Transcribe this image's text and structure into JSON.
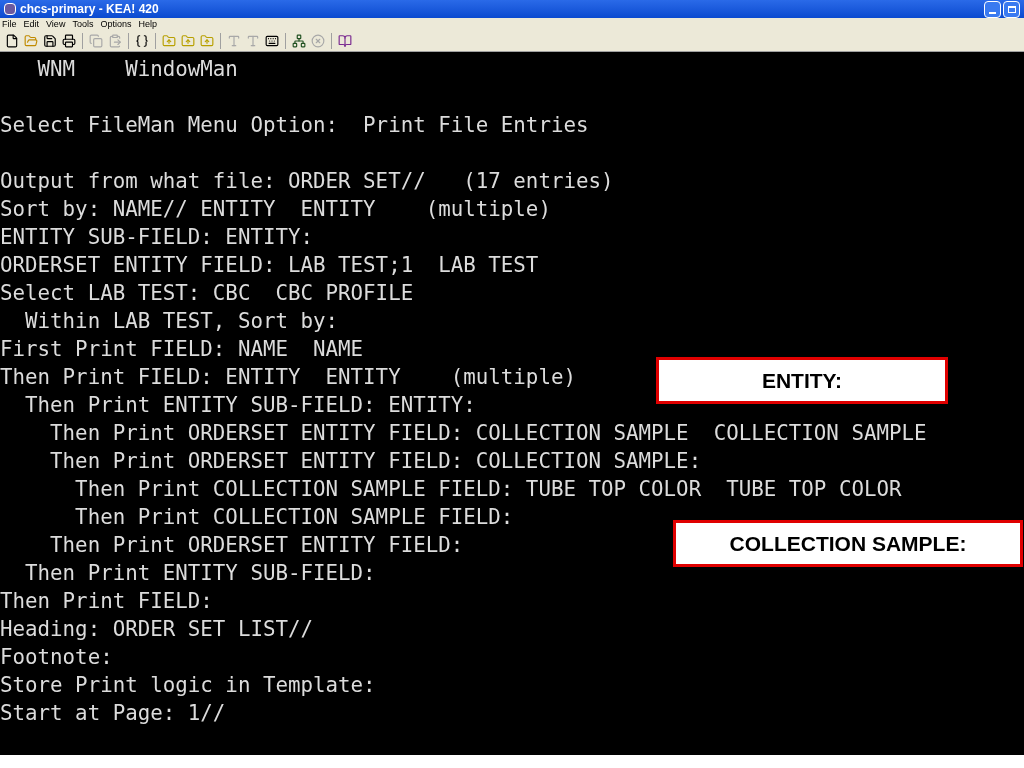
{
  "window": {
    "title": "chcs-primary - KEA! 420"
  },
  "menu": [
    "File",
    "Edit",
    "View",
    "Tools",
    "Options",
    "Help"
  ],
  "toolbar": [
    {
      "kind": "new",
      "disabled": false
    },
    {
      "kind": "open",
      "disabled": false
    },
    {
      "kind": "save",
      "disabled": false
    },
    {
      "kind": "print",
      "disabled": false
    },
    {
      "kind": "sep"
    },
    {
      "kind": "copy",
      "disabled": true
    },
    {
      "kind": "paste",
      "disabled": true
    },
    {
      "kind": "sep"
    },
    {
      "kind": "code",
      "disabled": false
    },
    {
      "kind": "sep"
    },
    {
      "kind": "folder-up",
      "disabled": false
    },
    {
      "kind": "folder-up",
      "disabled": false
    },
    {
      "kind": "folder-up",
      "disabled": false
    },
    {
      "kind": "sep"
    },
    {
      "kind": "font",
      "disabled": true
    },
    {
      "kind": "font",
      "disabled": true
    },
    {
      "kind": "keyboard",
      "disabled": false
    },
    {
      "kind": "sep"
    },
    {
      "kind": "connect",
      "disabled": false
    },
    {
      "kind": "stop",
      "disabled": true
    },
    {
      "kind": "sep"
    },
    {
      "kind": "book",
      "disabled": false
    }
  ],
  "terminal_blocks": [
    {
      "lines": [
        "   WNM    WindowMan"
      ]
    },
    {
      "lines": [
        "Select FileMan Menu Option:  Print File Entries"
      ]
    },
    {
      "lines": [
        "Output from what file: ORDER SET//   (17 entries)",
        "Sort by: NAME// ENTITY  ENTITY    (multiple)",
        "ENTITY SUB-FIELD: ENTITY:",
        "ORDERSET ENTITY FIELD: LAB TEST;1  LAB TEST",
        "Select LAB TEST: CBC  CBC PROFILE",
        "  Within LAB TEST, Sort by:",
        "First Print FIELD: NAME  NAME",
        "Then Print FIELD: ENTITY  ENTITY    (multiple)",
        "  Then Print ENTITY SUB-FIELD: ENTITY:",
        "    Then Print ORDERSET ENTITY FIELD: COLLECTION SAMPLE  COLLECTION SAMPLE",
        "    Then Print ORDERSET ENTITY FIELD: COLLECTION SAMPLE:",
        "      Then Print COLLECTION SAMPLE FIELD: TUBE TOP COLOR  TUBE TOP COLOR",
        "      Then Print COLLECTION SAMPLE FIELD:",
        "    Then Print ORDERSET ENTITY FIELD:",
        "  Then Print ENTITY SUB-FIELD:",
        "Then Print FIELD:",
        "Heading: ORDER SET LIST//",
        "Footnote:",
        "Store Print logic in Template:",
        "Start at Page: 1//"
      ]
    }
  ],
  "callouts": [
    "ENTITY:",
    "COLLECTION SAMPLE:"
  ]
}
